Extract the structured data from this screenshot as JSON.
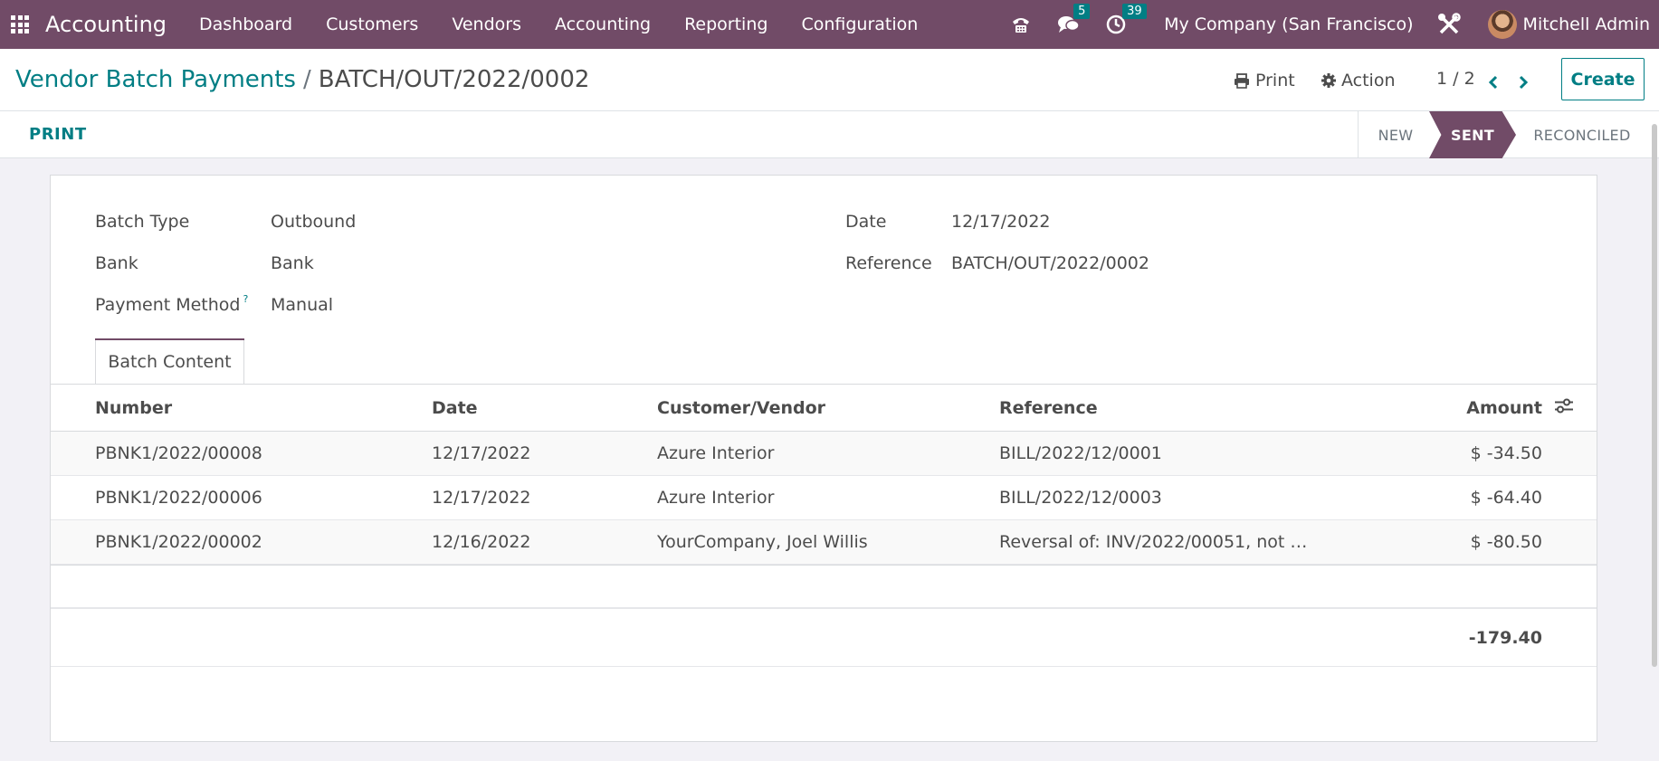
{
  "navbar": {
    "brand": "Accounting",
    "menu": [
      "Dashboard",
      "Customers",
      "Vendors",
      "Accounting",
      "Reporting",
      "Configuration"
    ],
    "messages_count": "5",
    "activities_count": "39",
    "company": "My Company (San Francisco)",
    "user": "Mitchell Admin"
  },
  "breadcrumb": {
    "parent": "Vendor Batch Payments",
    "separator": "/",
    "current": "BATCH/OUT/2022/0002"
  },
  "actions": {
    "print": "Print",
    "action": "Action",
    "pager": "1 / 2",
    "create": "Create"
  },
  "statusbar": {
    "print_button": "PRINT",
    "stages": [
      "NEW",
      "SENT",
      "RECONCILED"
    ],
    "active_stage": "SENT"
  },
  "form": {
    "batch_type_label": "Batch Type",
    "batch_type_value": "Outbound",
    "bank_label": "Bank",
    "bank_value": "Bank",
    "payment_method_label": "Payment Method",
    "payment_method_help": "?",
    "payment_method_value": "Manual",
    "date_label": "Date",
    "date_value": "12/17/2022",
    "reference_label": "Reference",
    "reference_value": "BATCH/OUT/2022/0002"
  },
  "tab": {
    "label": "Batch Content"
  },
  "table": {
    "headers": {
      "number": "Number",
      "date": "Date",
      "customer": "Customer/Vendor",
      "reference": "Reference",
      "amount": "Amount"
    },
    "rows": [
      {
        "number": "PBNK1/2022/00008",
        "date": "12/17/2022",
        "customer": "Azure Interior",
        "reference": "BILL/2022/12/0001",
        "amount": "$ -34.50"
      },
      {
        "number": "PBNK1/2022/00006",
        "date": "12/17/2022",
        "customer": "Azure Interior",
        "reference": "BILL/2022/12/0003",
        "amount": "$ -64.40"
      },
      {
        "number": "PBNK1/2022/00002",
        "date": "12/16/2022",
        "customer": "YourCompany, Joel Willis",
        "reference": "Reversal of: INV/2022/00051, not …",
        "amount": "$ -80.50"
      }
    ],
    "total": "-179.40"
  },
  "colors": {
    "brand_purple": "#714b67",
    "accent_teal": "#017e84"
  }
}
